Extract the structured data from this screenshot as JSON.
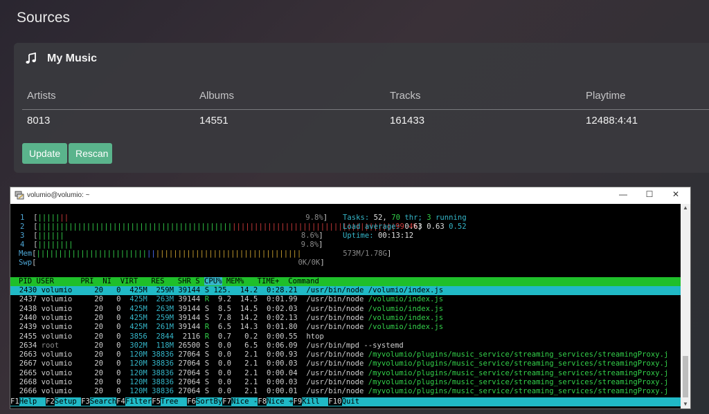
{
  "sources": {
    "title": "Sources",
    "card_title": "My Music",
    "headers": [
      "Artists",
      "Albums",
      "Tracks",
      "Playtime"
    ],
    "values": [
      "8013",
      "14551",
      "161433",
      "12488:4:41"
    ],
    "update_label": "Update",
    "rescan_label": "Rescan",
    "accent_color": "#5ab48c"
  },
  "terminal": {
    "title": "volumio@volumio: ~",
    "window_controls": [
      "—",
      "☐",
      "✕"
    ],
    "cpu": [
      {
        "id": "1",
        "percent": "9.8%"
      },
      {
        "id": "2",
        "percent": "99.4%"
      },
      {
        "id": "3",
        "percent": "8.6%"
      },
      {
        "id": "4",
        "percent": "9.8%"
      }
    ],
    "mem": {
      "label": "Mem",
      "value": "573M/1.78G"
    },
    "swp": {
      "label": "Swp",
      "value": "0K/0K"
    },
    "tasks": {
      "label": "Tasks:",
      "count": "52,",
      "thr": "70",
      "thr_label": "thr;",
      "running": "3",
      "running_label": "running"
    },
    "load": {
      "label": "Load average:",
      "v1": "0.63",
      "v2": "0.63",
      "v3": "0.52"
    },
    "uptime": {
      "label": "Uptime:",
      "value": "00:13:12"
    },
    "columns": [
      "PID",
      "USER",
      "PRI",
      "NI",
      "VIRT",
      "RES",
      "SHR",
      "S",
      "CPU%",
      "MEM%",
      "TIME+",
      "Command"
    ],
    "processes": [
      {
        "pid": "2430",
        "user": "volumio",
        "pri": "20",
        "ni": "0",
        "virt": "425M",
        "res": "259M",
        "shr": "39144",
        "s": "S",
        "cpu": "125.",
        "mem": "14.2",
        "time": "0:28.21",
        "cmd": "/usr/bin/node /volumio/index.js"
      },
      {
        "pid": "2437",
        "user": "volumio",
        "pri": "20",
        "ni": "0",
        "virt": "425M",
        "res": "263M",
        "shr": "39144",
        "s": "R",
        "cpu": "9.2",
        "mem": "14.5",
        "time": "0:01.99",
        "cmd": "/usr/bin/node /volumio/index.js"
      },
      {
        "pid": "2438",
        "user": "volumio",
        "pri": "20",
        "ni": "0",
        "virt": "425M",
        "res": "263M",
        "shr": "39144",
        "s": "S",
        "cpu": "8.5",
        "mem": "14.5",
        "time": "0:02.03",
        "cmd": "/usr/bin/node /volumio/index.js"
      },
      {
        "pid": "2440",
        "user": "volumio",
        "pri": "20",
        "ni": "0",
        "virt": "425M",
        "res": "259M",
        "shr": "39144",
        "s": "S",
        "cpu": "7.8",
        "mem": "14.2",
        "time": "0:02.13",
        "cmd": "/usr/bin/node /volumio/index.js"
      },
      {
        "pid": "2439",
        "user": "volumio",
        "pri": "20",
        "ni": "0",
        "virt": "425M",
        "res": "261M",
        "shr": "39144",
        "s": "R",
        "cpu": "6.5",
        "mem": "14.3",
        "time": "0:01.80",
        "cmd": "/usr/bin/node /volumio/index.js"
      },
      {
        "pid": "2455",
        "user": "volumio",
        "pri": "20",
        "ni": "0",
        "virt": "3856",
        "res": "2844",
        "shr": "2116",
        "s": "R",
        "cpu": "0.7",
        "mem": "0.2",
        "time": "0:00.55",
        "cmd": "htop"
      },
      {
        "pid": "2634",
        "user": "root",
        "pri": "20",
        "ni": "0",
        "virt": "302M",
        "res": "118M",
        "shr": "26500",
        "s": "S",
        "cpu": "0.0",
        "mem": "6.5",
        "time": "0:06.09",
        "cmd": "/usr/bin/mpd --systemd"
      },
      {
        "pid": "2663",
        "user": "volumio",
        "pri": "20",
        "ni": "0",
        "virt": "120M",
        "res": "38836",
        "shr": "27064",
        "s": "S",
        "cpu": "0.0",
        "mem": "2.1",
        "time": "0:00.93",
        "cmd": "/usr/bin/node /myvolumio/plugins/music_service/streaming_services/streamingProxy.j"
      },
      {
        "pid": "2667",
        "user": "volumio",
        "pri": "20",
        "ni": "0",
        "virt": "120M",
        "res": "38836",
        "shr": "27064",
        "s": "S",
        "cpu": "0.0",
        "mem": "2.1",
        "time": "0:00.03",
        "cmd": "/usr/bin/node /myvolumio/plugins/music_service/streaming_services/streamingProxy.j"
      },
      {
        "pid": "2665",
        "user": "volumio",
        "pri": "20",
        "ni": "0",
        "virt": "120M",
        "res": "38836",
        "shr": "27064",
        "s": "S",
        "cpu": "0.0",
        "mem": "2.1",
        "time": "0:00.04",
        "cmd": "/usr/bin/node /myvolumio/plugins/music_service/streaming_services/streamingProxy.j"
      },
      {
        "pid": "2668",
        "user": "volumio",
        "pri": "20",
        "ni": "0",
        "virt": "120M",
        "res": "38836",
        "shr": "27064",
        "s": "S",
        "cpu": "0.0",
        "mem": "2.1",
        "time": "0:00.03",
        "cmd": "/usr/bin/node /myvolumio/plugins/music_service/streaming_services/streamingProxy.j"
      },
      {
        "pid": "2666",
        "user": "volumio",
        "pri": "20",
        "ni": "0",
        "virt": "120M",
        "res": "38836",
        "shr": "27064",
        "s": "S",
        "cpu": "0.0",
        "mem": "2.1",
        "time": "0:00.01",
        "cmd": "/usr/bin/node /myvolumio/plugins/music_service/streaming_services/streamingProxy.j"
      }
    ],
    "function_keys": [
      {
        "key": "F1",
        "label": "Help  "
      },
      {
        "key": "F2",
        "label": "Setup "
      },
      {
        "key": "F3",
        "label": "Search"
      },
      {
        "key": "F4",
        "label": "Filter"
      },
      {
        "key": "F5",
        "label": "Tree  "
      },
      {
        "key": "F6",
        "label": "SortBy"
      },
      {
        "key": "F7",
        "label": "Nice -"
      },
      {
        "key": "F8",
        "label": "Nice +"
      },
      {
        "key": "F9",
        "label": "Kill  "
      },
      {
        "key": "F10",
        "label": "Quit"
      }
    ]
  }
}
